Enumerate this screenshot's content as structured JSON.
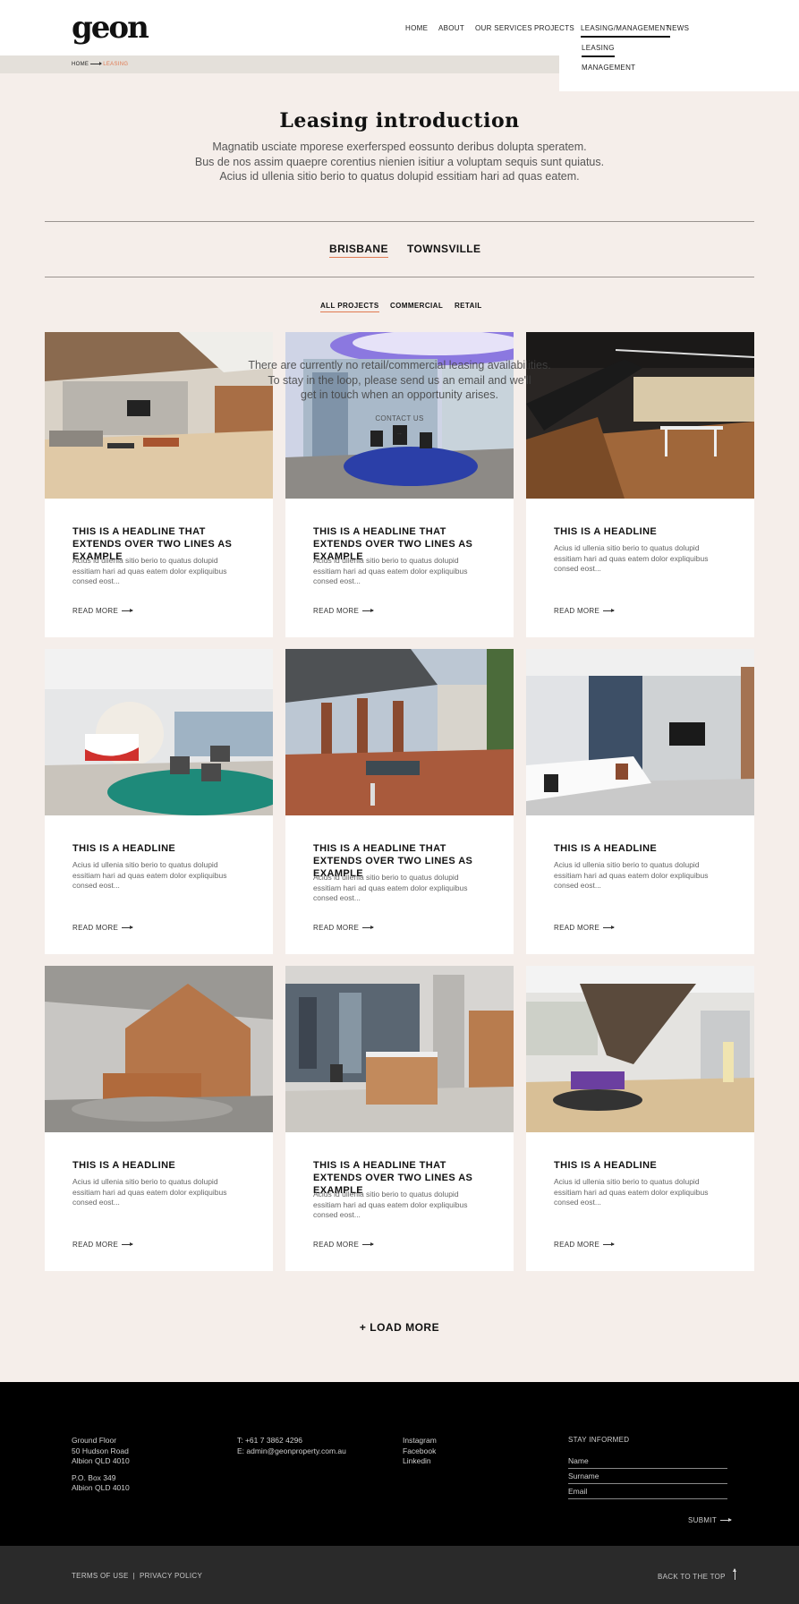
{
  "header": {
    "logo": "geon",
    "nav": [
      {
        "label": "Home"
      },
      {
        "label": "About"
      },
      {
        "label": "Our Services"
      },
      {
        "label": "Projects"
      },
      {
        "label": "Leasing/Management",
        "active": true
      },
      {
        "label": "News"
      }
    ],
    "dropdown": [
      {
        "label": "Leasing",
        "active": true
      },
      {
        "label": "Management"
      }
    ]
  },
  "breadcrumb": {
    "home": "Home",
    "current": "Leasing"
  },
  "intro": {
    "title": "Leasing introduction",
    "lines": [
      "Magnatib usciate mporese exerfersped eossunto deribus dolupta speratem.",
      "Bus de nos assim quaepre corentius nienien isitiur a voluptam sequis sunt quiatus.",
      "Acius id ullenia sitio berio to quatus dolupid essitiam hari ad quas eatem."
    ]
  },
  "city_tabs": [
    {
      "label": "Brisbane",
      "active": true
    },
    {
      "label": "Townsville"
    }
  ],
  "filters": [
    {
      "label": "All Projects",
      "active": true
    },
    {
      "label": "Commercial"
    },
    {
      "label": "Retail"
    }
  ],
  "notice": {
    "lines": [
      "There are currently no retail/commercial leasing availabilities.",
      "To stay in the loop, please send us an email and we'll",
      "get in touch when an opportunity arises."
    ],
    "contact": "Contact us"
  },
  "cards": [
    {
      "title": "This is a headline that extends over two lines as example",
      "excerpt": "Acius id ullenia sitio berio to quatus dolupid essitiam hari ad quas eatem dolor expliquibus consed eost...",
      "more": "Read more",
      "scene": "lounge"
    },
    {
      "title": "This is a headline that extends over two lines as example",
      "excerpt": "Acius id ullenia sitio berio to quatus dolupid essitiam hari ad quas eatem dolor expliquibus consed eost...",
      "more": "Read more",
      "scene": "purple"
    },
    {
      "title": "This is a headline",
      "excerpt": "Acius id ullenia sitio berio to quatus dolupid essitiam hari ad quas eatem dolor expliquibus consed eost...",
      "more": "Read more",
      "scene": "stairs"
    },
    {
      "title": "This is a headline",
      "excerpt": "Acius id ullenia sitio berio to quatus dolupid essitiam hari ad quas eatem dolor expliquibus consed eost...",
      "more": "Read more",
      "scene": "reception"
    },
    {
      "title": "This is a headline that extends over two lines as example",
      "excerpt": "Acius id ullenia sitio berio to quatus dolupid essitiam hari ad quas eatem dolor expliquibus consed eost...",
      "more": "Read more",
      "scene": "courtyard"
    },
    {
      "title": "This is a headline",
      "excerpt": "Acius id ullenia sitio berio to quatus dolupid essitiam hari ad quas eatem dolor expliquibus consed eost...",
      "more": "Read more",
      "scene": "office"
    },
    {
      "title": "This is a headline",
      "excerpt": "Acius id ullenia sitio berio to quatus dolupid essitiam hari ad quas eatem dolor expliquibus consed eost...",
      "more": "Read more",
      "scene": "timber"
    },
    {
      "title": "This is a headline that extends over two lines as example",
      "excerpt": "Acius id ullenia sitio berio to quatus dolupid essitiam hari ad quas eatem dolor expliquibus consed eost...",
      "more": "Read more",
      "scene": "kitchen"
    },
    {
      "title": "This is a headline",
      "excerpt": "Acius id ullenia sitio berio to quatus dolupid essitiam hari ad quas eatem dolor expliquibus consed eost...",
      "more": "Read more",
      "scene": "staircase"
    }
  ],
  "load_more": "+ Load more",
  "footer": {
    "address": [
      "Ground Floor",
      "50 Hudson Road",
      "Albion QLD 4010"
    ],
    "po": [
      "P.O. Box 349",
      "Albion QLD 4010"
    ],
    "phone": "T: +61 7 3862 4296",
    "email": "E: admin@geonproperty.com.au",
    "social": [
      "Instagram",
      "Facebook",
      "Linkedin"
    ],
    "stay_informed": "Stay informed",
    "fields": [
      "Name",
      "Surname",
      "Email"
    ],
    "submit": "Submit"
  },
  "subfooter": {
    "terms": "Terms of use",
    "separator": "|",
    "privacy": "Privacy policy",
    "back_to_top": "Back to the top"
  },
  "colors": {
    "background": "#f5eeea",
    "accent": "#e07a52",
    "footer": "#000000",
    "subfooter": "#2a2a2a"
  }
}
